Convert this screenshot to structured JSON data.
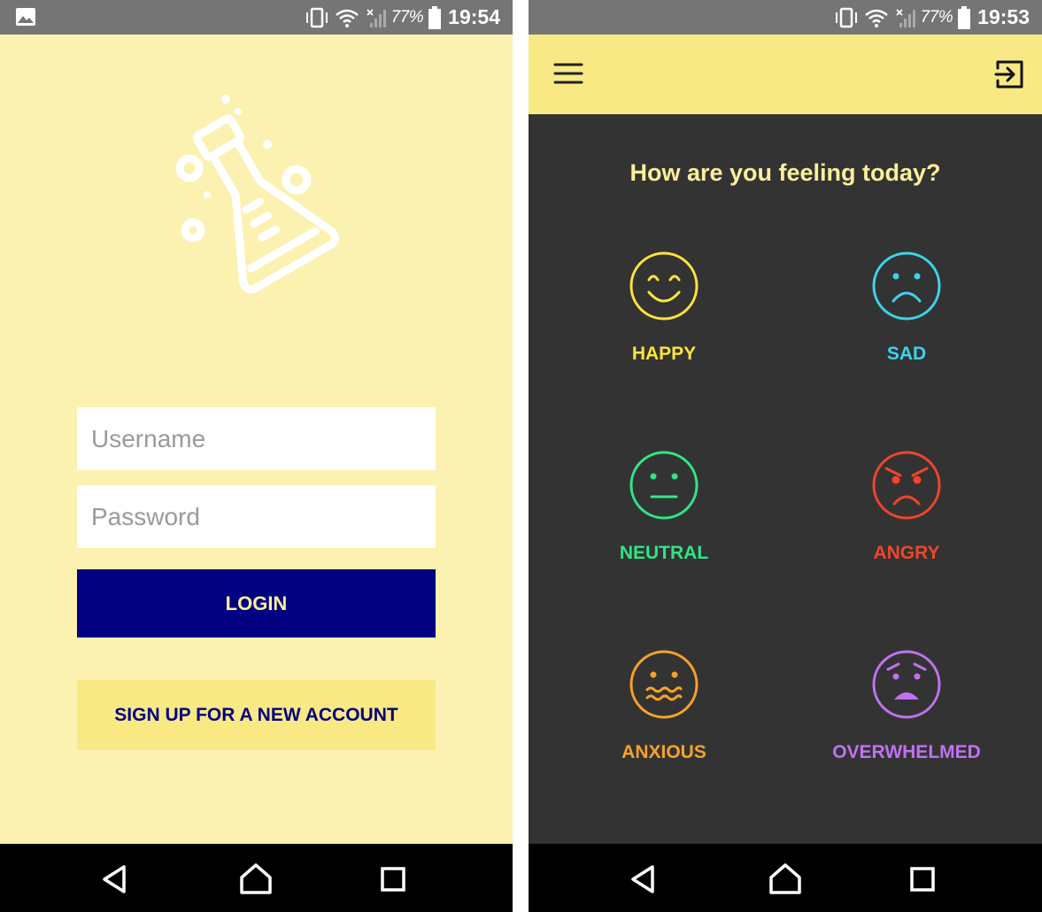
{
  "login_screen": {
    "status": {
      "battery": "77%",
      "time": "19:54"
    },
    "username": {
      "placeholder": "Username",
      "value": ""
    },
    "password": {
      "placeholder": "Password",
      "value": ""
    },
    "login_label": "LOGIN",
    "signup_label": "SIGN UP FOR A NEW ACCOUNT",
    "colors": {
      "background": "#FBF1B1",
      "primary": "#000080",
      "accent": "#F9E985"
    }
  },
  "mood_screen": {
    "status": {
      "battery": "77%",
      "time": "19:53"
    },
    "question": "How are you feeling today?",
    "moods": [
      {
        "label": "HAPPY",
        "color": "#FDE33A",
        "icon": "happy-face-icon"
      },
      {
        "label": "SAD",
        "color": "#3DD3EA",
        "icon": "sad-face-icon"
      },
      {
        "label": "NEUTRAL",
        "color": "#2EE686",
        "icon": "neutral-face-icon"
      },
      {
        "label": "ANGRY",
        "color": "#F0452B",
        "icon": "angry-face-icon"
      },
      {
        "label": "ANXIOUS",
        "color": "#F6A22A",
        "icon": "anxious-face-icon"
      },
      {
        "label": "OVERWHELMED",
        "color": "#C072F0",
        "icon": "overwhelmed-face-icon"
      }
    ],
    "colors": {
      "background": "#333333",
      "app_bar": "#F9E985"
    }
  }
}
